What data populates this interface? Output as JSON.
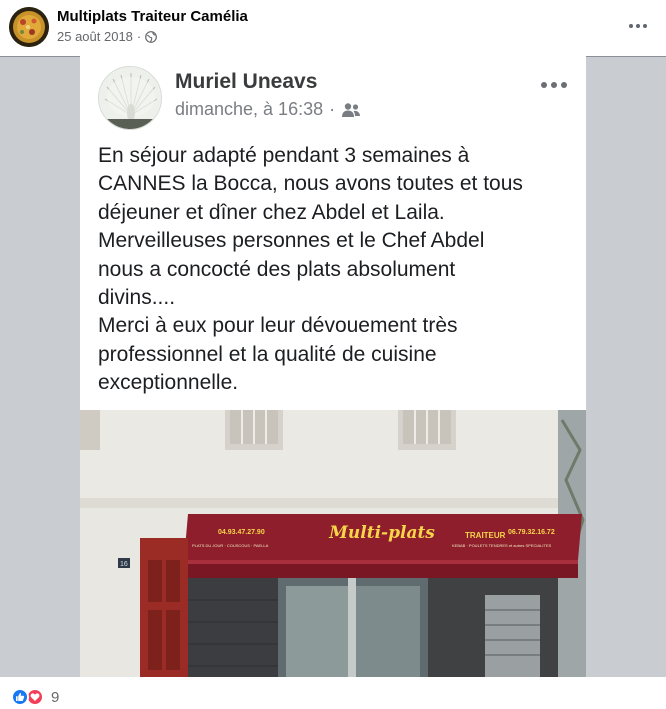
{
  "post": {
    "page_name": "Multiplats Traiteur Camélia",
    "date": "25 août 2018",
    "separator": "·",
    "privacy_icon": "globe-icon",
    "more_icon": "more-horizontal-icon"
  },
  "inner_post": {
    "author": "Muriel Uneavs",
    "time": "dimanche, à 16:38",
    "separator": "·",
    "audience_icon": "friends-icon",
    "more_icon": "more-horizontal-icon",
    "text": "En séjour adapté pendant 3 semaines à\nCANNES la Bocca, nous avons toutes et tous\ndéjeuner et dîner chez Abdel et Laila.\nMerveilleuses personnes et le Chef Abdel\nnous a concocté des plats absolument\ndivins....\nMerci à eux pour leur dévouement très\nprofessionnel et la qualité de cuisine\nexceptionnelle."
  },
  "storefront": {
    "awning_title": "Multi-plats",
    "awning_subtitle": "TRAITEUR",
    "phone_left": "04.93.47.27.90",
    "phone_right": "06.79.32.16.72",
    "services_left": "PLATS DU JOUR · COUSCOUS · PAELLA",
    "services_right": "KEBAB · POULETS TENDRES et autres SPECIALITES",
    "door_number": "16"
  },
  "reactions": {
    "icons": [
      "like-icon",
      "love-icon"
    ],
    "count": "9"
  },
  "colors": {
    "like": "#1877f2",
    "love": "#f33e58",
    "awning": "#8e1e2b",
    "awning_text": "#f6d54a",
    "accent": "#4267b2"
  }
}
